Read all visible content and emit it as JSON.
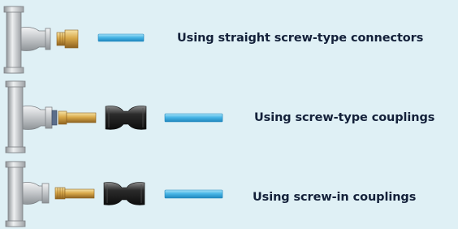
{
  "rows": [
    {
      "caption": "Using straight screw-type connectors",
      "parts": [
        "tee-fitting",
        "brass-connector",
        "blue-pipe"
      ]
    },
    {
      "caption": "Using screw-type couplings",
      "parts": [
        "tee-fitting",
        "brass-adapter",
        "black-coupling",
        "blue-pipe"
      ]
    },
    {
      "caption": "Using screw-in couplings",
      "parts": [
        "tee-fitting",
        "brass-adapter",
        "black-coupling",
        "blue-pipe"
      ]
    }
  ],
  "colors": {
    "background": "#dff0f5",
    "caption_text": "#14213a",
    "steel": "#c9ccd0",
    "brass": "#d9a94a",
    "coupling": "#2b2b2b",
    "pipe": "#49b6e6"
  }
}
